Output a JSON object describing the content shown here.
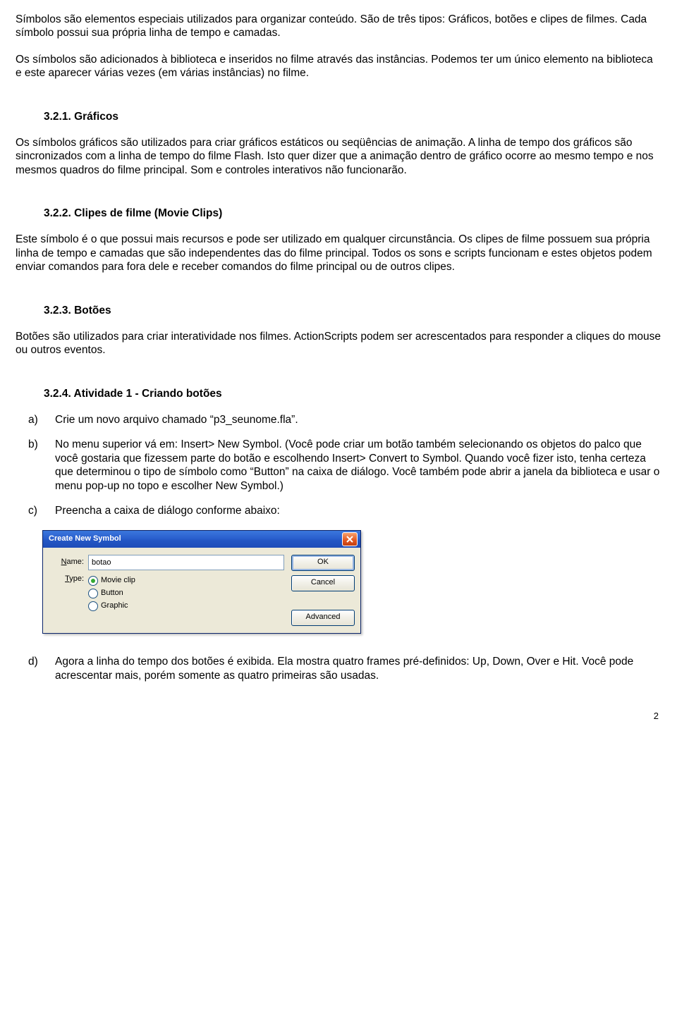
{
  "intro": {
    "p1": "Símbolos são elementos especiais utilizados para organizar conteúdo. São de três tipos: Gráficos, botões e clipes de filmes. Cada símbolo possui sua própria linha de tempo e camadas.",
    "p2": "Os símbolos são adicionados à biblioteca e inseridos no filme através das instâncias. Podemos ter um único elemento na biblioteca e este aparecer várias vezes (em várias instâncias) no filme."
  },
  "sections": {
    "s1": {
      "heading": "3.2.1.   Gráficos",
      "body": "Os símbolos gráficos são utilizados para criar gráficos estáticos ou seqüências de animação. A linha de tempo dos gráficos são sincronizados com a linha de tempo do filme Flash. Isto quer dizer que a animação dentro de gráfico ocorre ao mesmo tempo e nos mesmos quadros do filme principal. Som e controles interativos não funcionarão."
    },
    "s2": {
      "heading": "3.2.2.   Clipes de filme (Movie Clips)",
      "body": "Este símbolo é o que possui mais recursos e pode ser utilizado em qualquer circunstância. Os clipes de filme possuem sua própria linha de tempo e camadas que são independentes das do filme principal. Todos os sons e scripts funcionam e estes objetos podem enviar comandos para fora dele e receber comandos do filme principal ou de outros clipes."
    },
    "s3": {
      "heading": "3.2.3.   Botões",
      "body": "Botões são utilizados para criar interatividade nos filmes. ActionScripts podem ser acrescentados para responder a cliques do mouse ou outros eventos."
    },
    "s4": {
      "heading": "3.2.4.   Atividade 1 - Criando botões"
    }
  },
  "steps": {
    "a": {
      "marker": "a)",
      "text": "Crie um novo arquivo chamado “p3_seunome.fla”."
    },
    "b": {
      "marker": "b)",
      "text": "No menu superior vá em: Insert> New Symbol. (Você pode criar um botão também selecionando os objetos do palco que você gostaria que fizessem parte do botão e escolhendo Insert> Convert to Symbol. Quando você fizer isto, tenha certeza que determinou o tipo de símbolo como “Button” na caixa de diálogo. Você também pode abrir a janela da biblioteca e usar o menu pop-up no topo e escolher New Symbol.)"
    },
    "c": {
      "marker": "c)",
      "text": "Preencha a caixa de diálogo conforme abaixo:"
    },
    "d": {
      "marker": "d)",
      "text": " Agora a linha do tempo dos botões é exibida. Ela mostra quatro frames pré-definidos: Up, Down, Over e Hit. Você pode acrescentar mais, porém somente as quatro primeiras são usadas."
    }
  },
  "dialog": {
    "title": "Create New Symbol",
    "name_label": "Name:",
    "type_label": "Type:",
    "name_value": "botao",
    "options": {
      "movie": "Movie clip",
      "button": "Button",
      "graphic": "Graphic"
    },
    "buttons": {
      "ok": "OK",
      "cancel": "Cancel",
      "advanced": "Advanced"
    }
  },
  "page_number": "2"
}
